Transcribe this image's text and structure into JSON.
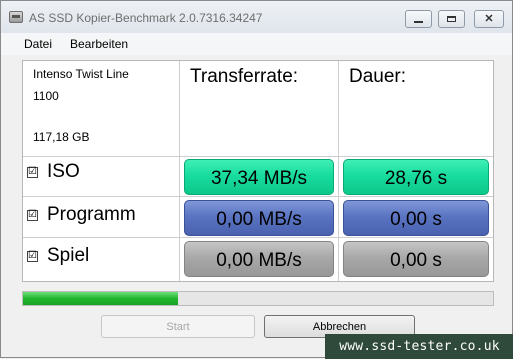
{
  "window": {
    "title": "AS SSD Kopier-Benchmark 2.0.7316.34247",
    "icons": {
      "app": "disk-icon",
      "minimize": "minimize-icon",
      "maximize": "maximize-icon",
      "close": "close-icon"
    }
  },
  "menu": {
    "items": [
      "Datei",
      "Bearbeiten"
    ]
  },
  "drive": {
    "name": "Intenso Twist Line",
    "model": "1100",
    "size": "117,18 GB"
  },
  "columns": {
    "rate": "Transferrate:",
    "time": "Dauer:"
  },
  "rows": [
    {
      "label": "ISO",
      "checked": true,
      "check_glyph": "☑",
      "rate": "37,34 MB/s",
      "time": "28,76 s",
      "status_color": "#18dc9e"
    },
    {
      "label": "Programm",
      "checked": true,
      "check_glyph": "☑",
      "rate": "0,00 MB/s",
      "time": "0,00 s",
      "status_color": "#5a74c2"
    },
    {
      "label": "Spiel",
      "checked": true,
      "check_glyph": "☑",
      "rate": "0,00 MB/s",
      "time": "0,00 s",
      "status_color": "#a8a8a8"
    }
  ],
  "progress": {
    "fraction": 0.33,
    "color": "#21b52f"
  },
  "buttons": {
    "start": "Start",
    "cancel": "Abbrechen"
  },
  "watermark": "www.ssd-tester.co.uk"
}
